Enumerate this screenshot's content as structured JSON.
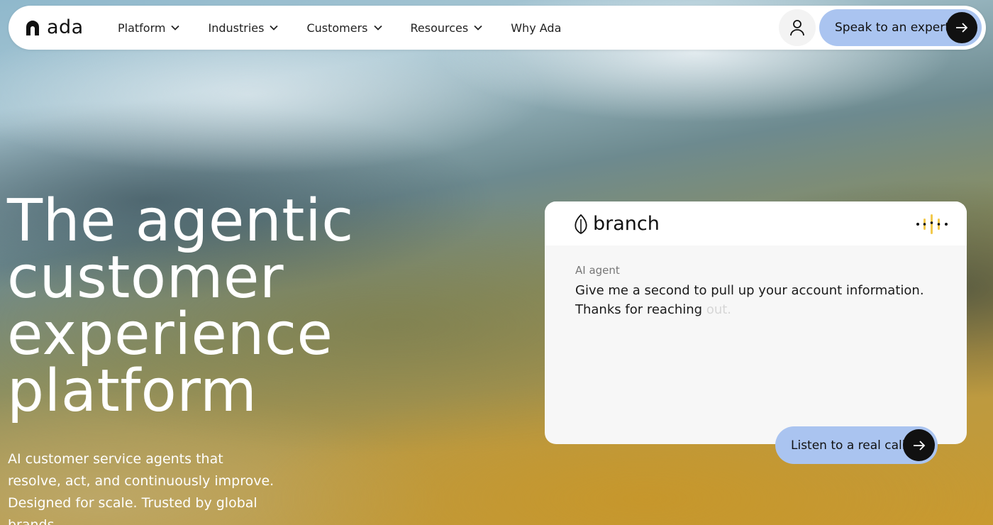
{
  "nav": {
    "logo_text": "ada",
    "items": [
      {
        "label": "Platform",
        "has_dropdown": true
      },
      {
        "label": "Industries",
        "has_dropdown": true
      },
      {
        "label": "Customers",
        "has_dropdown": true
      },
      {
        "label": "Resources",
        "has_dropdown": true
      },
      {
        "label": "Why Ada",
        "has_dropdown": false
      }
    ],
    "user_icon": "user-icon",
    "cta_label": "Speak to an expert"
  },
  "hero": {
    "title_lines": [
      "The agentic",
      "customer",
      "experience",
      "platform"
    ],
    "subtitle": "AI customer service agents that resolve, act, and continuously improve. Designed for scale. Trusted by global brands."
  },
  "demo_card": {
    "brand_name": "branch",
    "speaker": "AI agent",
    "message_visible": "Give me a second to pull up your account information. Thanks for reaching ",
    "message_faded": "out.",
    "listen_label": "Listen to a real call"
  },
  "colors": {
    "accent_button": "#aac4f0",
    "arrow_circle": "#111111",
    "wave_accent": "#f2c94c"
  }
}
